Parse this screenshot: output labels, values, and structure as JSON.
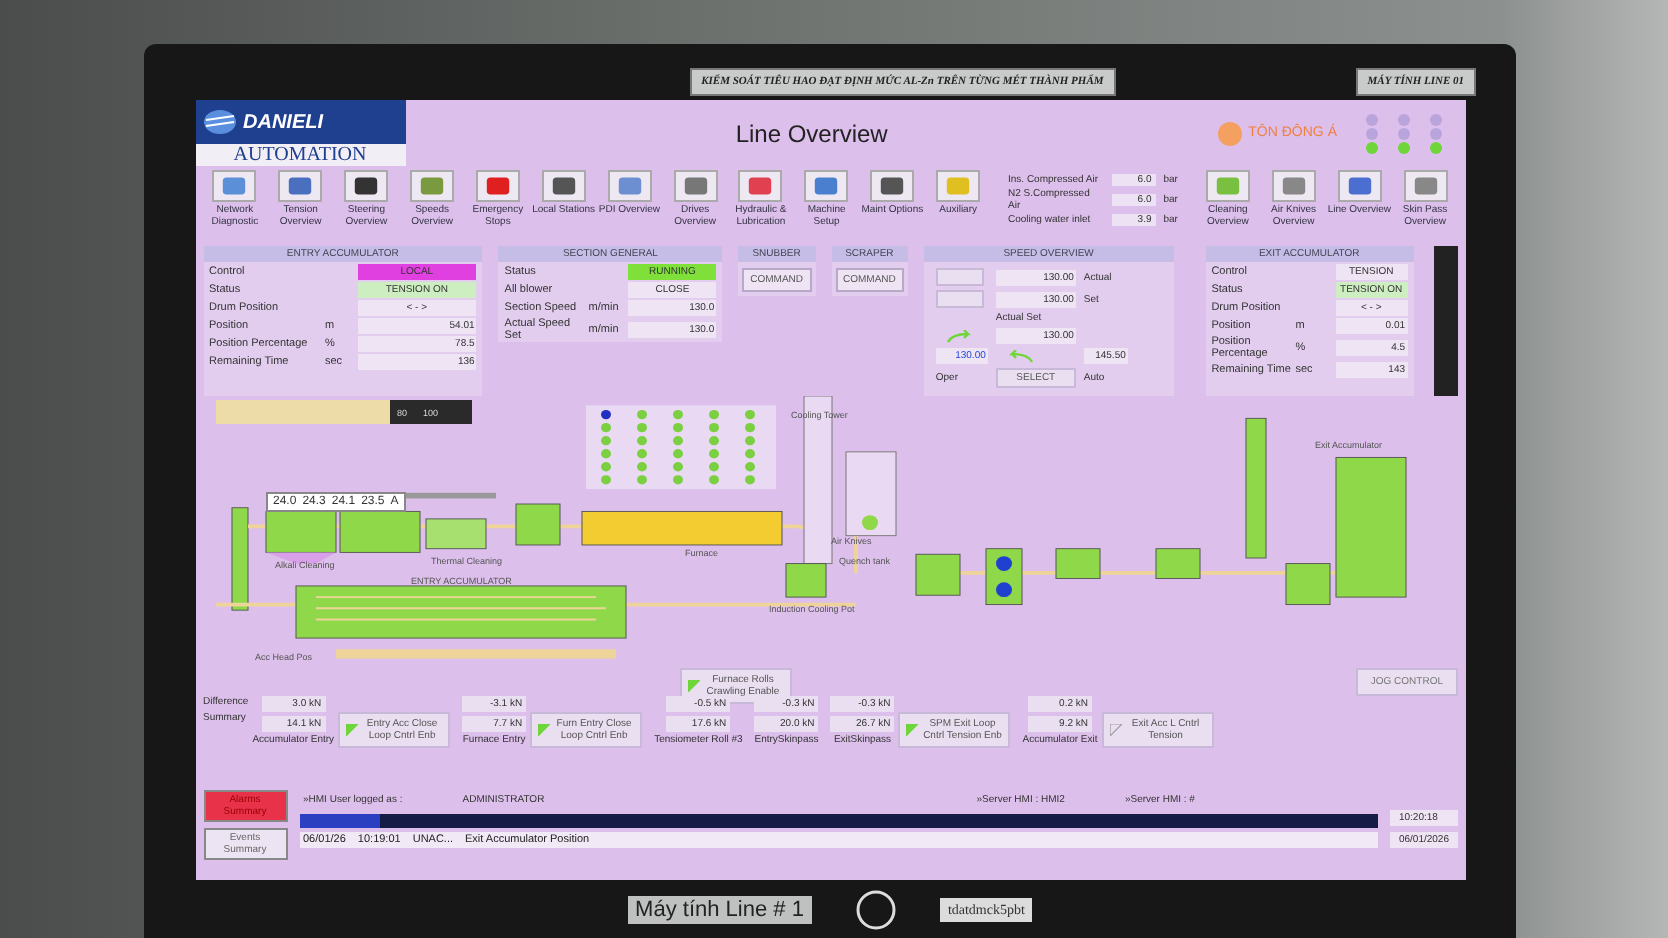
{
  "monitor_labels": {
    "top_plate": "KIỂM SOÁT TIÊU HAO ĐẠT ĐỊNH MỨC AL-Zn TRÊN TỪNG MÉT THÀNH PHẨM",
    "right_plate": "MÁY TÍNH LINE 01",
    "bottom_plate": "Máy tính Line # 1",
    "bottom_sticker": "tdatdmck5pbt"
  },
  "brand": {
    "name": "DANIELI",
    "subtitle": "AUTOMATION",
    "partner": "TÔN ĐÔNG Á"
  },
  "title": "Line Overview",
  "status_lamps": [
    {
      "lamps": [
        {
          "on": false
        },
        {
          "on": false
        },
        {
          "on": true
        }
      ]
    },
    {
      "lamps": [
        {
          "on": false
        },
        {
          "on": false
        },
        {
          "on": true
        }
      ]
    },
    {
      "lamps": [
        {
          "on": false
        },
        {
          "on": false
        },
        {
          "on": true
        }
      ]
    }
  ],
  "toolbar": [
    {
      "label": "Network Diagnostic"
    },
    {
      "label": "Tension Overview"
    },
    {
      "label": "Steering Overview"
    },
    {
      "label": "Speeds Overview"
    },
    {
      "label": "Emergency Stops"
    },
    {
      "label": "Local Stations"
    },
    {
      "label": "PDI Overview"
    },
    {
      "label": "Drives Overview"
    },
    {
      "label": "Hydraulic & Lubrication"
    },
    {
      "label": "Machine Setup"
    },
    {
      "label": "Maint Options"
    },
    {
      "label": "Auxiliary"
    }
  ],
  "utilities": [
    {
      "label": "Ins. Compressed Air",
      "value": "6.0",
      "unit": "bar"
    },
    {
      "label": "N2 S.Compressed Air",
      "value": "6.0",
      "unit": "bar"
    },
    {
      "label": "Cooling water inlet",
      "value": "3.9",
      "unit": "bar"
    }
  ],
  "overview_buttons": [
    {
      "label": "Cleaning Overview"
    },
    {
      "label": "Air Knives Overview"
    },
    {
      "label": "Line Overview"
    },
    {
      "label": "Skin Pass Overview"
    }
  ],
  "entry_accumulator": {
    "title": "ENTRY ACCUMULATOR",
    "rows": [
      {
        "label": "Control",
        "value": "LOCAL",
        "color": "#e040e0"
      },
      {
        "label": "Status",
        "value": "TENSION ON",
        "color": "#cdeec0"
      },
      {
        "label": "Drum Position",
        "value": "< - >"
      },
      {
        "label": "Position",
        "unit": "m",
        "value": "54.01"
      },
      {
        "label": "Position Percentage",
        "unit": "%",
        "value": "78.5"
      },
      {
        "label": "Remaining Time",
        "unit": "sec",
        "value": "136"
      }
    ]
  },
  "section_general": {
    "title": "SECTION GENERAL",
    "rows": [
      {
        "label": "Status",
        "value": "RUNNING",
        "color": "#7fe03a"
      },
      {
        "label": "All blower",
        "value": "CLOSE"
      },
      {
        "label": "Section Speed",
        "unit": "m/min",
        "value": "130.0"
      },
      {
        "label": "Actual Speed Set",
        "unit": "m/min",
        "value": "130.0"
      }
    ]
  },
  "snubber": {
    "title": "SNUBBER",
    "button": "COMMAND"
  },
  "scraper": {
    "title": "SCRAPER",
    "button": "COMMAND"
  },
  "speed_overview": {
    "title": "SPEED OVERVIEW",
    "actual": "130.00",
    "actual_label": "Actual",
    "set": "130.00",
    "set_label": "Set",
    "actual_set_label": "Actual Set",
    "actual_set": "130.00",
    "oper_value": "130.00",
    "auto_value": "145.50",
    "oper_label": "Oper",
    "select_button": "SELECT",
    "auto_label": "Auto"
  },
  "exit_accumulator": {
    "title": "EXIT ACCUMULATOR",
    "rows": [
      {
        "label": "Control",
        "value": "TENSION"
      },
      {
        "label": "Status",
        "value": "TENSION ON",
        "color": "#cdeec0"
      },
      {
        "label": "Drum Position",
        "value": "< - >"
      },
      {
        "label": "Position",
        "unit": "m",
        "value": "0.01"
      },
      {
        "label": "Position Percentage",
        "unit": "%",
        "value": "4.5"
      },
      {
        "label": "Remaining Time",
        "unit": "sec",
        "value": "143"
      }
    ]
  },
  "acc_gauge": {
    "level": 0.68,
    "tick_labels": [
      "80",
      "100"
    ]
  },
  "cleaning_currents": [
    "24.0",
    "24.3",
    "24.1",
    "23.5"
  ],
  "current_unit": "A",
  "diagram_labels": [
    "Cooling Tower",
    "Exit Accumulator",
    "Air Knives",
    "Furnace",
    "Thermal Cleaning",
    "Quench tank",
    "Alkali Cleaning",
    "ENTRY ACCUMULATOR",
    "Induction Cooling Pot",
    "Acc Head Pos"
  ],
  "furnace_rolls": {
    "label": "Furnace Rolls Crawling Enable",
    "enabled": true
  },
  "tension_groups": [
    {
      "values": [
        "3.0 kN",
        "14.1 kN"
      ],
      "row_labels": [
        "Difference",
        "Summary"
      ],
      "label": "Accumulator Entry",
      "loop_button": {
        "label": "Entry Acc Close Loop Cntrl Enb",
        "enabled": true
      }
    },
    {
      "values": [
        "-3.1 kN",
        "7.7 kN"
      ],
      "label": "Furnace Entry",
      "loop_button": {
        "label": "Furn Entry Close Loop Cntrl Enb",
        "enabled": true
      }
    },
    {
      "values": [
        "-0.5 kN",
        "17.6 kN"
      ],
      "label": "Tensiometer Roll #3"
    },
    {
      "values": [
        "-0.3 kN",
        "20.0 kN"
      ],
      "label": "EntrySkinpass"
    },
    {
      "values": [
        "-0.3 kN",
        "26.7 kN"
      ],
      "label": "ExitSkinpass",
      "loop_button": {
        "label": "SPM Exit Loop Cntrl Tension Enb",
        "enabled": true
      }
    },
    {
      "values": [
        "0.2 kN",
        "9.2 kN"
      ],
      "label": "Accumulator Exit",
      "loop_button": {
        "label": "Exit Acc L Cntrl Tension",
        "enabled": false
      }
    }
  ],
  "jog_button": "JOG CONTROL",
  "footer": {
    "alarms_button": "Alarms Summary",
    "events_button": "Events Summary",
    "user_label": "»HMI User logged as :",
    "user": "ADMINISTRATOR",
    "server_1": "»Server HMI : HMI2",
    "server_2": "»Server HMI : #",
    "message": {
      "date": "06/01/26",
      "time": "10:19:01",
      "source": "UNAC...",
      "text": "Exit Accumulator Position"
    },
    "clock_time": "10:20:18",
    "clock_date": "06/01/2026"
  }
}
